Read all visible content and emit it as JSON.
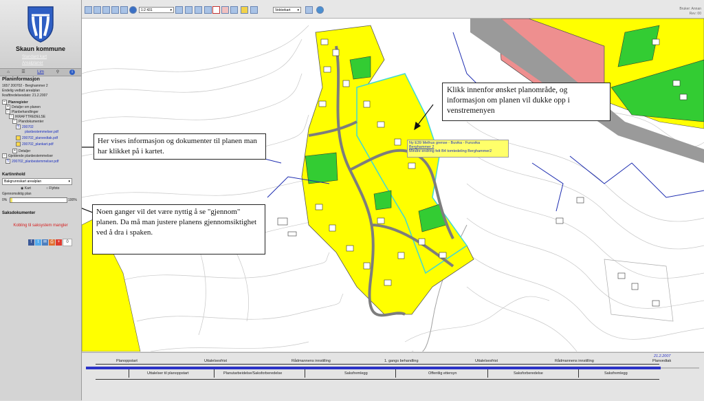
{
  "sidebar": {
    "municipality": "Skaun kommune",
    "map_links": [
      "Standard kart",
      "Arealplaner"
    ],
    "tabs": [
      "",
      "",
      "Lim",
      "",
      ""
    ],
    "plan_header": "Planinformasjon",
    "plan_lines": [
      "1657 200702 - Berghammer 2",
      "Endelig vedtatt arealplan",
      "Ikrafttredelsesdato: 21.2.2007"
    ],
    "tree": {
      "planregister": "Planregister",
      "detaljer_om_planen": "Detaljer om planen",
      "planbehandlinger": "Planbehandlinger",
      "ikrafttredelse": "IKRAFTTREDELSE",
      "plandokumenter": "Plandokumenter",
      "doc1_id": "200702",
      "doc1_name": "planbestemmelser.pdf",
      "doc2": "200702_planvedtak.pdf",
      "doc3": "200702_plankart.pdf",
      "detaljer": "Detaljer",
      "gjeldende": "Gjeldende planbestemmelser",
      "doc4": "200702_planbestemmelser.pdf"
    },
    "kartinnhold": "Kartinnhold",
    "basemap_select": "Bakgrunnskart arealplan",
    "radio_kart": "Kart",
    "radio_flyfoto": "Flyfoto",
    "transparency_label": "Gjennomsiktig plan",
    "slider_min": "0%",
    "slider_max": "100%",
    "slider_fraction": 0.04,
    "saksdokumenter": "Saksdokumenter",
    "saksystem_msg": "Kobling til saksystem mangler",
    "share_count": "0"
  },
  "toolbar": {
    "scale_value": "1:2 431",
    "layer_select": "Vektorkart",
    "user_line1": "Bruker: Annan",
    "user_line2": "Rev: 00"
  },
  "map": {
    "plan_label_1": "Ny E39 Melhus grense - Buvika - Furuvika",
    "plan_label_2": "Berghammer 2",
    "plan_label_3": "Mindre endring felt B4 tomtedeling Berghammer2",
    "callouts": {
      "click_info": "Klikk innenfor ønsket planområde, og informasjon om planen vil dukke opp i venstremenyen",
      "docs_info": "Her vises informasjon og dokumenter til planen man har klikket på i kartet.",
      "transparency_info": "Noen ganger vil det være nyttig å se \"gjennom\" planen. Da må man justere planens gjennomsiktighet ved å dra i spaken."
    }
  },
  "timeline": {
    "top_labels": [
      "Planoppstart",
      "Uttalelsesfrist",
      "Rådmannens innstilling",
      "1. gangs behandling",
      "Uttalelsesfrist",
      "Rådmannens innstilling",
      "Planvedtak"
    ],
    "bottom_labels": [
      "Uttalelser til planoppstart",
      "Planutarbeidelse/Saksforberedelse",
      "Saksfremlegg",
      "Offentlig ettersyn",
      "Saksforberedelse",
      "Saksfremlegg"
    ],
    "date": "21.2.2007"
  },
  "colors": {
    "plan_yellow": "#ffff00",
    "green_area": "#33cc33",
    "pink_area": "#ee8f8f",
    "timeline_bar": "#2b33c7",
    "outline_cyan": "#3dd8d8"
  }
}
